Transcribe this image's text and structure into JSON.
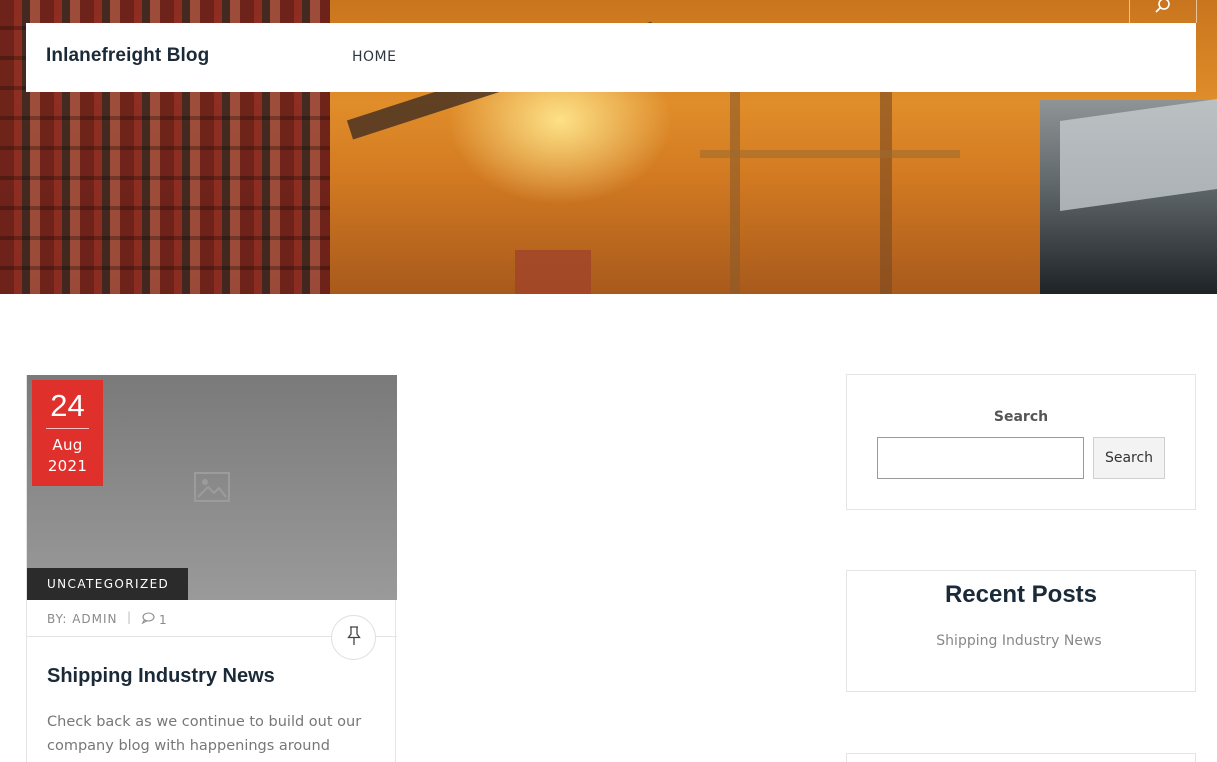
{
  "header": {
    "site_title": "Inlanefreight Blog",
    "nav": [
      {
        "label": "HOME"
      }
    ],
    "search_toggle_icon": "search-icon"
  },
  "post": {
    "date": {
      "day": "24",
      "month": "Aug",
      "year": "2021"
    },
    "image_icon": "image-placeholder-icon",
    "category": "UNCATEGORIZED",
    "meta": {
      "by_label": "BY:",
      "author": "ADMIN",
      "divider": "|",
      "comments_count": "1"
    },
    "pin_icon": "pin-icon",
    "title": "Shipping Industry News",
    "excerpt": "Check back as we continue to build out our company blog with happenings around"
  },
  "sidebar": {
    "search": {
      "label": "Search",
      "input_value": "",
      "button_label": "Search"
    },
    "recent_posts": {
      "heading": "Recent Posts",
      "items": [
        {
          "title": "Shipping Industry News"
        }
      ]
    }
  },
  "colors": {
    "accent_red": "#e0302c",
    "category_bg": "#2b2b2b",
    "title_dark": "#1b2a38"
  }
}
